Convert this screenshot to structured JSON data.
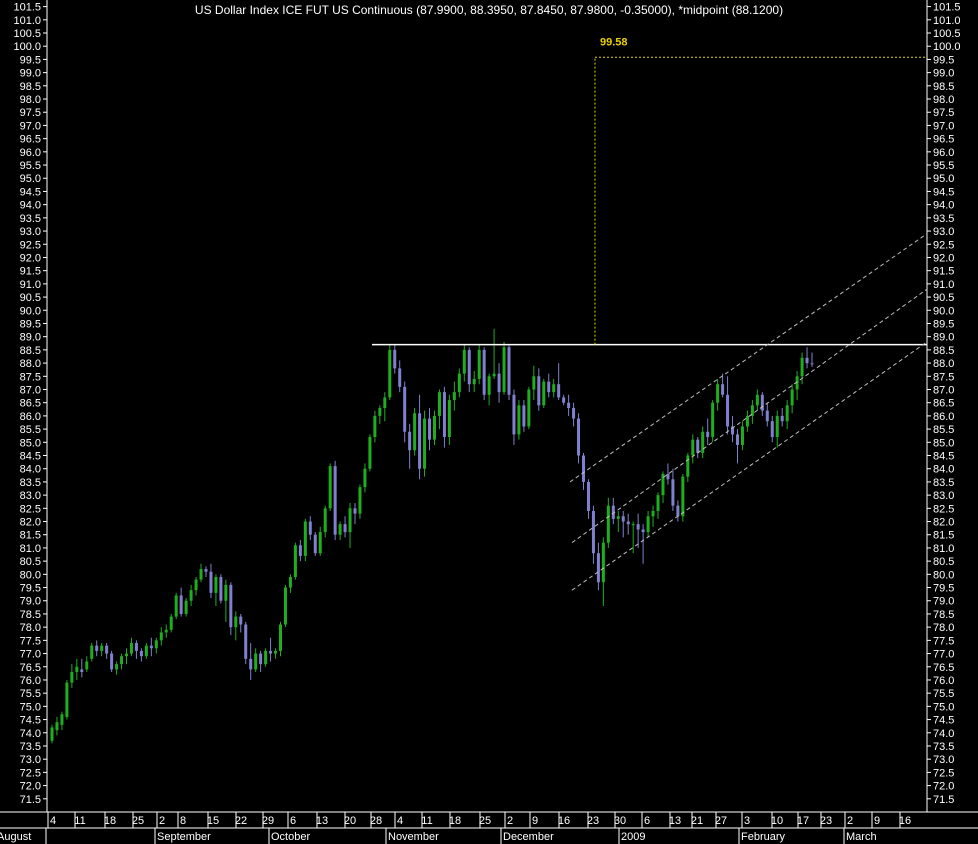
{
  "chart_data": {
    "type": "candlestick",
    "title": "US Dollar Index ICE FUT US Continuous (87.9900, 88.3950, 87.8450, 87.9800, -0.35000), *midpoint (88.1200)",
    "ylim": [
      71.0,
      101.75
    ],
    "y_ticks": [
      "71.5",
      "72.0",
      "72.5",
      "73.0",
      "73.5",
      "74.0",
      "74.5",
      "75.0",
      "75.5",
      "76.0",
      "76.5",
      "77.0",
      "77.5",
      "78.0",
      "78.5",
      "79.0",
      "79.5",
      "80.0",
      "80.5",
      "81.0",
      "81.5",
      "82.0",
      "82.5",
      "83.0",
      "83.5",
      "84.0",
      "84.5",
      "85.0",
      "85.5",
      "86.0",
      "86.5",
      "87.0",
      "87.5",
      "88.0",
      "88.5",
      "89.0",
      "89.5",
      "90.0",
      "90.5",
      "91.0",
      "91.5",
      "92.0",
      "92.5",
      "93.0",
      "93.5",
      "94.0",
      "94.5",
      "95.0",
      "95.5",
      "96.0",
      "96.5",
      "97.0",
      "97.5",
      "98.0",
      "98.5",
      "99.0",
      "99.5",
      "100.0",
      "100.5",
      "101.0",
      "101.5"
    ],
    "x_day_ticks": [
      "4",
      "11",
      "18",
      "25",
      "2",
      "8",
      "15",
      "22",
      "29",
      "6",
      "13",
      "20",
      "28",
      "4",
      "11",
      "18",
      "25",
      "2",
      "9",
      "16",
      "23",
      "30",
      "6",
      "13",
      "21",
      "27",
      "3",
      "10",
      "17",
      "23",
      "2",
      "9",
      "16"
    ],
    "x_month_labels": [
      "August",
      "September",
      "October",
      "November",
      "December",
      "2009",
      "February",
      "March"
    ],
    "annotation": "99.58",
    "colors": {
      "up": "#1fae1f",
      "down": "#8080d0",
      "resistance": "#ffffff",
      "target": "#e8d000",
      "channel": "#bfbfbf",
      "axis": "#ffffff"
    },
    "candles": [
      [
        73.7,
        74.3,
        73.6,
        74.2
      ],
      [
        74.1,
        74.6,
        73.9,
        74.4
      ],
      [
        74.3,
        74.8,
        74.1,
        74.7
      ],
      [
        74.6,
        76.0,
        74.5,
        75.9
      ],
      [
        75.9,
        76.6,
        75.7,
        76.3
      ],
      [
        76.3,
        76.8,
        76.0,
        76.5
      ],
      [
        76.4,
        76.8,
        76.1,
        76.3
      ],
      [
        76.4,
        76.9,
        76.3,
        76.7
      ],
      [
        76.8,
        77.4,
        76.7,
        77.3
      ],
      [
        77.3,
        77.5,
        76.9,
        77.1
      ],
      [
        77.1,
        77.4,
        76.9,
        77.3
      ],
      [
        77.3,
        77.4,
        76.8,
        77.0
      ],
      [
        77.0,
        77.1,
        76.3,
        76.4
      ],
      [
        76.4,
        76.7,
        76.2,
        76.6
      ],
      [
        76.6,
        77.0,
        76.4,
        76.9
      ],
      [
        76.9,
        77.2,
        76.6,
        77.0
      ],
      [
        77.0,
        77.6,
        76.9,
        77.4
      ],
      [
        77.4,
        77.5,
        76.8,
        77.1
      ],
      [
        77.1,
        77.2,
        76.7,
        76.9
      ],
      [
        76.9,
        77.4,
        76.8,
        77.3
      ],
      [
        77.3,
        77.6,
        76.9,
        77.2
      ],
      [
        77.2,
        77.6,
        77.0,
        77.5
      ],
      [
        77.5,
        78.0,
        77.3,
        77.8
      ],
      [
        77.8,
        78.1,
        77.6,
        77.9
      ],
      [
        77.9,
        78.5,
        77.8,
        78.4
      ],
      [
        78.4,
        79.3,
        78.3,
        79.2
      ],
      [
        79.2,
        79.5,
        78.4,
        78.5
      ],
      [
        78.5,
        79.1,
        78.4,
        79.0
      ],
      [
        79.0,
        79.6,
        78.8,
        79.4
      ],
      [
        79.4,
        79.9,
        79.2,
        79.8
      ],
      [
        79.8,
        80.4,
        79.7,
        80.2
      ],
      [
        80.2,
        80.3,
        79.9,
        80.1
      ],
      [
        80.1,
        80.4,
        79.1,
        79.3
      ],
      [
        79.3,
        80.0,
        78.8,
        79.9
      ],
      [
        79.9,
        80.0,
        78.9,
        79.0
      ],
      [
        79.0,
        79.8,
        78.2,
        79.6
      ],
      [
        79.6,
        79.7,
        77.7,
        78.0
      ],
      [
        78.0,
        78.6,
        77.5,
        78.4
      ],
      [
        78.4,
        78.5,
        77.8,
        78.1
      ],
      [
        78.1,
        78.2,
        76.6,
        76.8
      ],
      [
        76.8,
        77.4,
        76.0,
        76.4
      ],
      [
        76.4,
        77.2,
        76.3,
        77.0
      ],
      [
        77.0,
        77.1,
        76.3,
        76.6
      ],
      [
        76.6,
        77.2,
        76.5,
        77.1
      ],
      [
        77.1,
        77.6,
        76.7,
        77.0
      ],
      [
        77.0,
        77.2,
        76.8,
        77.1
      ],
      [
        77.1,
        78.2,
        76.9,
        78.1
      ],
      [
        78.1,
        79.6,
        78.0,
        79.5
      ],
      [
        79.5,
        80.0,
        79.3,
        79.9
      ],
      [
        79.9,
        81.2,
        79.8,
        81.1
      ],
      [
        81.1,
        81.3,
        80.5,
        80.7
      ],
      [
        80.7,
        82.1,
        80.5,
        82.0
      ],
      [
        82.0,
        82.2,
        81.3,
        81.5
      ],
      [
        81.5,
        81.6,
        80.7,
        80.8
      ],
      [
        80.8,
        81.8,
        80.7,
        81.6
      ],
      [
        81.6,
        82.6,
        81.4,
        82.5
      ],
      [
        82.5,
        84.2,
        82.4,
        84.1
      ],
      [
        84.1,
        84.3,
        81.3,
        81.5
      ],
      [
        81.5,
        82.0,
        81.3,
        81.9
      ],
      [
        81.9,
        82.2,
        81.4,
        81.6
      ],
      [
        81.6,
        82.7,
        81.0,
        82.5
      ],
      [
        82.5,
        82.7,
        81.9,
        82.3
      ],
      [
        82.3,
        83.4,
        82.1,
        83.3
      ],
      [
        83.3,
        84.2,
        83.1,
        84.0
      ],
      [
        84.0,
        85.3,
        83.9,
        85.2
      ],
      [
        85.2,
        86.2,
        85.0,
        86.0
      ],
      [
        86.0,
        86.4,
        85.7,
        86.3
      ],
      [
        86.3,
        86.9,
        85.8,
        86.7
      ],
      [
        86.7,
        88.7,
        86.6,
        88.5
      ],
      [
        88.5,
        88.7,
        87.6,
        87.8
      ],
      [
        87.8,
        88.1,
        86.9,
        87.1
      ],
      [
        87.1,
        87.3,
        85.0,
        85.4
      ],
      [
        85.4,
        85.7,
        84.0,
        84.7
      ],
      [
        84.7,
        86.3,
        84.5,
        86.1
      ],
      [
        86.1,
        86.8,
        83.6,
        84.0
      ],
      [
        84.0,
        86.2,
        83.7,
        85.9
      ],
      [
        85.9,
        86.3,
        84.7,
        85.1
      ],
      [
        85.1,
        86.2,
        84.9,
        86.0
      ],
      [
        86.0,
        87.0,
        85.5,
        86.9
      ],
      [
        86.9,
        87.1,
        84.8,
        85.2
      ],
      [
        85.2,
        86.8,
        84.9,
        86.6
      ],
      [
        86.6,
        87.3,
        86.2,
        86.9
      ],
      [
        86.9,
        87.8,
        86.7,
        87.6
      ],
      [
        87.6,
        88.7,
        87.3,
        88.5
      ],
      [
        88.5,
        88.6,
        86.9,
        87.2
      ],
      [
        87.2,
        87.7,
        86.9,
        87.4
      ],
      [
        87.4,
        88.7,
        87.2,
        88.5
      ],
      [
        88.5,
        88.6,
        86.6,
        86.8
      ],
      [
        86.8,
        87.6,
        86.4,
        87.5
      ],
      [
        87.5,
        89.3,
        87.4,
        87.6
      ],
      [
        87.6,
        88.0,
        86.5,
        86.9
      ],
      [
        86.9,
        88.8,
        86.8,
        88.6
      ],
      [
        88.6,
        88.7,
        86.6,
        86.8
      ],
      [
        86.8,
        87.0,
        84.9,
        85.3
      ],
      [
        85.3,
        86.6,
        85.1,
        86.4
      ],
      [
        86.4,
        86.6,
        85.4,
        85.6
      ],
      [
        85.6,
        87.1,
        85.5,
        87.0
      ],
      [
        87.0,
        87.9,
        86.6,
        87.5
      ],
      [
        87.5,
        87.8,
        86.2,
        86.4
      ],
      [
        86.4,
        87.4,
        86.3,
        87.3
      ],
      [
        87.3,
        87.6,
        86.7,
        86.9
      ],
      [
        86.9,
        87.4,
        86.7,
        87.2
      ],
      [
        87.2,
        88.0,
        86.6,
        86.7
      ],
      [
        86.7,
        86.8,
        86.4,
        86.5
      ],
      [
        86.5,
        86.8,
        86.0,
        86.3
      ],
      [
        86.3,
        86.5,
        85.6,
        85.9
      ],
      [
        85.9,
        86.1,
        84.2,
        84.5
      ],
      [
        84.5,
        84.6,
        83.2,
        83.5
      ],
      [
        83.5,
        83.6,
        82.1,
        82.4
      ],
      [
        82.4,
        82.6,
        80.4,
        80.8
      ],
      [
        80.8,
        81.2,
        79.4,
        79.7
      ],
      [
        79.7,
        81.4,
        78.8,
        81.2
      ],
      [
        81.2,
        82.9,
        81.0,
        82.6
      ],
      [
        82.6,
        82.9,
        81.9,
        82.1
      ],
      [
        82.1,
        82.4,
        81.6,
        82.2
      ],
      [
        82.2,
        82.4,
        81.4,
        82.0
      ],
      [
        82.0,
        82.3,
        81.5,
        81.9
      ],
      [
        81.9,
        82.0,
        80.8,
        81.9
      ],
      [
        81.9,
        82.3,
        81.0,
        81.7
      ],
      [
        81.7,
        81.9,
        80.4,
        81.6
      ],
      [
        81.6,
        82.4,
        81.4,
        82.2
      ],
      [
        82.2,
        82.6,
        81.8,
        82.4
      ],
      [
        82.4,
        83.1,
        82.1,
        83.0
      ],
      [
        83.0,
        83.9,
        82.7,
        83.8
      ],
      [
        83.8,
        84.2,
        83.4,
        83.6
      ],
      [
        83.6,
        84.0,
        82.4,
        82.6
      ],
      [
        82.6,
        82.8,
        82.0,
        82.2
      ],
      [
        82.2,
        83.8,
        82.0,
        83.7
      ],
      [
        83.7,
        84.6,
        83.5,
        84.5
      ],
      [
        84.5,
        85.3,
        84.2,
        85.1
      ],
      [
        85.1,
        85.2,
        84.4,
        84.6
      ],
      [
        84.6,
        85.6,
        84.4,
        85.4
      ],
      [
        85.4,
        85.9,
        84.9,
        85.2
      ],
      [
        85.2,
        86.6,
        85.0,
        86.5
      ],
      [
        86.5,
        87.4,
        86.2,
        87.2
      ],
      [
        87.2,
        87.6,
        86.7,
        86.8
      ],
      [
        86.8,
        87.5,
        85.3,
        85.6
      ],
      [
        85.6,
        86.0,
        85.0,
        85.3
      ],
      [
        85.3,
        85.5,
        84.2,
        84.9
      ],
      [
        84.9,
        85.8,
        84.7,
        85.6
      ],
      [
        85.6,
        86.2,
        85.4,
        86.0
      ],
      [
        86.0,
        86.6,
        85.7,
        86.4
      ],
      [
        86.4,
        87.0,
        86.2,
        86.8
      ],
      [
        86.8,
        86.9,
        86.0,
        86.2
      ],
      [
        86.2,
        86.5,
        85.6,
        85.8
      ],
      [
        85.8,
        86.0,
        85.0,
        85.2
      ],
      [
        85.2,
        86.2,
        84.8,
        86.0
      ],
      [
        86.0,
        86.3,
        85.6,
        85.8
      ],
      [
        85.8,
        86.6,
        85.5,
        86.4
      ],
      [
        86.4,
        87.2,
        86.1,
        87.0
      ],
      [
        87.0,
        87.7,
        86.6,
        87.5
      ],
      [
        87.5,
        88.4,
        87.2,
        88.2
      ],
      [
        88.2,
        88.6,
        87.8,
        88.0
      ],
      [
        87.99,
        88.4,
        87.85,
        87.98
      ]
    ]
  }
}
